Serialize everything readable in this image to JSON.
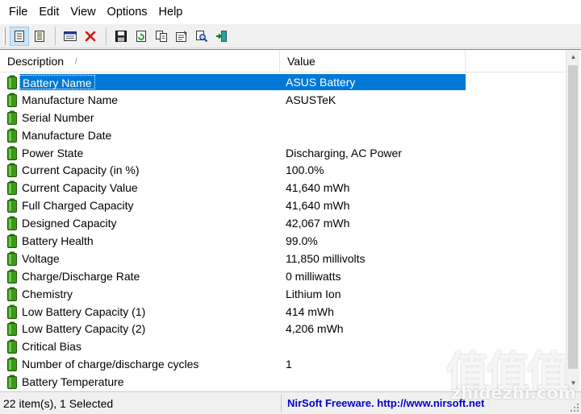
{
  "menu": [
    "File",
    "Edit",
    "View",
    "Options",
    "Help"
  ],
  "toolbar": {
    "buttons": [
      {
        "icon": "html-report-icon",
        "active": true
      },
      {
        "icon": "report-all-icon",
        "active": false
      },
      {
        "icon": "properties-window-icon",
        "active": false
      },
      {
        "icon": "delete-x-icon",
        "active": false
      },
      {
        "icon": "save-disk-icon",
        "active": false
      },
      {
        "icon": "refresh-icon",
        "active": false
      },
      {
        "icon": "copy-icon",
        "active": false
      },
      {
        "icon": "properties-icon",
        "active": false
      },
      {
        "icon": "find-icon",
        "active": false
      },
      {
        "icon": "exit-icon",
        "active": false
      }
    ]
  },
  "table": {
    "columns": [
      "Description",
      "Value"
    ],
    "sort_indicator": "/",
    "rows": [
      {
        "description": "Battery Name",
        "value": "ASUS Battery",
        "selected": true
      },
      {
        "description": "Manufacture Name",
        "value": "ASUSTeK"
      },
      {
        "description": "Serial Number",
        "value": ""
      },
      {
        "description": "Manufacture Date",
        "value": ""
      },
      {
        "description": "Power State",
        "value": "Discharging, AC Power"
      },
      {
        "description": "Current Capacity (in %)",
        "value": "100.0%"
      },
      {
        "description": "Current Capacity Value",
        "value": "41,640 mWh"
      },
      {
        "description": "Full Charged Capacity",
        "value": "41,640 mWh"
      },
      {
        "description": "Designed Capacity",
        "value": "42,067 mWh"
      },
      {
        "description": "Battery Health",
        "value": "99.0%"
      },
      {
        "description": "Voltage",
        "value": "11,850 millivolts"
      },
      {
        "description": "Charge/Discharge Rate",
        "value": "0 milliwatts"
      },
      {
        "description": "Chemistry",
        "value": "Lithium Ion"
      },
      {
        "description": "Low Battery Capacity (1)",
        "value": "414 mWh"
      },
      {
        "description": "Low Battery Capacity (2)",
        "value": "4,206 mWh"
      },
      {
        "description": "Critical Bias",
        "value": ""
      },
      {
        "description": "Number of charge/discharge cycles",
        "value": "1"
      },
      {
        "description": "Battery Temperature",
        "value": ""
      }
    ]
  },
  "status": {
    "items": "22 item(s), 1 Selected",
    "credit": "NirSoft Freeware.  http://www.nirsoft.net"
  },
  "watermark": {
    "main": "值值值",
    "sub": "zhidezhi.com"
  },
  "colors": {
    "selection": "#0078d7",
    "battery_green": "#3a9a1a",
    "link_blue": "#0000cc"
  }
}
